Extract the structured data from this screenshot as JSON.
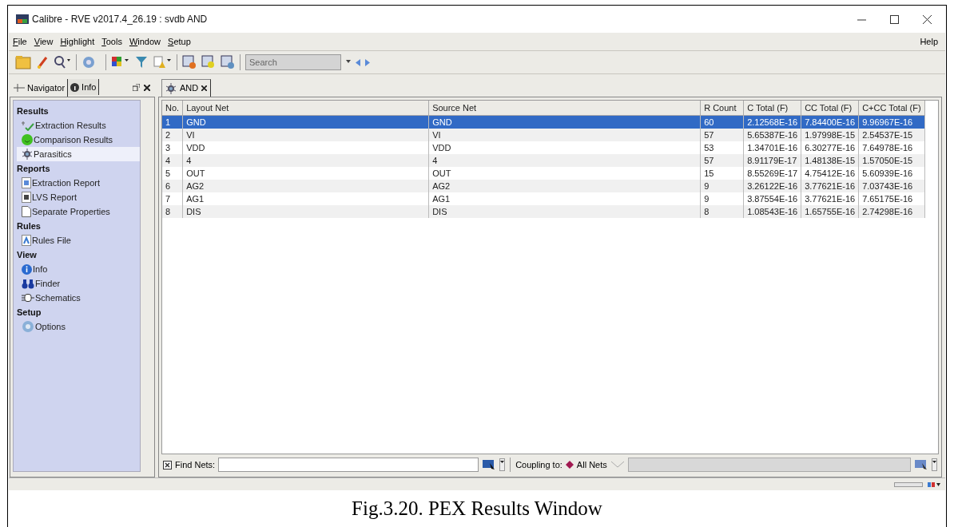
{
  "window": {
    "title": "Calibre - RVE v2017.4_26.19 : svdb AND"
  },
  "menu": [
    "File",
    "View",
    "Highlight",
    "Tools",
    "Window",
    "Setup"
  ],
  "help": "Help",
  "toolbar": {
    "search": {
      "placeholder": "Search"
    }
  },
  "side_tabs": [
    {
      "label": "Navigator",
      "selected": true
    },
    {
      "label": "Info",
      "selected": false
    }
  ],
  "navigator": [
    {
      "heading": "Results",
      "items": [
        {
          "label": "Extraction Results",
          "kind": "extraction",
          "selected": false
        },
        {
          "label": "Comparison Results",
          "kind": "smiley",
          "selected": false
        },
        {
          "label": "Parasitics",
          "kind": "bug",
          "selected": true
        }
      ]
    },
    {
      "heading": "Reports",
      "items": [
        {
          "label": "Extraction Report",
          "kind": "reportE",
          "selected": false
        },
        {
          "label": "LVS Report",
          "kind": "reportL",
          "selected": false
        },
        {
          "label": "Separate Properties",
          "kind": "page",
          "selected": false
        }
      ]
    },
    {
      "heading": "Rules",
      "items": [
        {
          "label": "Rules File",
          "kind": "rules",
          "selected": false
        }
      ]
    },
    {
      "heading": "View",
      "items": [
        {
          "label": "Info",
          "kind": "info",
          "selected": false
        },
        {
          "label": "Finder",
          "kind": "binoculars",
          "selected": false
        },
        {
          "label": "Schematics",
          "kind": "schematic",
          "selected": false
        }
      ]
    },
    {
      "heading": "Setup",
      "items": [
        {
          "label": "Options",
          "kind": "gear",
          "selected": false
        }
      ]
    }
  ],
  "doc_tabs": [
    {
      "label": "AND",
      "selected": true
    }
  ],
  "table": {
    "columns": [
      "No.",
      "Layout Net",
      "Source Net",
      "R Count",
      "C Total (F)",
      "CC Total (F)",
      "C+CC Total (F)"
    ],
    "rows": [
      {
        "cells": [
          "1",
          "GND",
          "GND",
          "60",
          "2.12568E-16",
          "7.84400E-16",
          "9.96967E-16"
        ],
        "selected": true
      },
      {
        "cells": [
          "2",
          "VI",
          "VI",
          "57",
          "5.65387E-16",
          "1.97998E-15",
          "2.54537E-15"
        ],
        "selected": false
      },
      {
        "cells": [
          "3",
          "VDD",
          "VDD",
          "53",
          "1.34701E-16",
          "6.30277E-16",
          "7.64978E-16"
        ],
        "selected": false
      },
      {
        "cells": [
          "4",
          "4",
          "4",
          "57",
          "8.91179E-17",
          "1.48138E-15",
          "1.57050E-15"
        ],
        "selected": false
      },
      {
        "cells": [
          "5",
          "OUT",
          "OUT",
          "15",
          "8.55269E-17",
          "4.75412E-16",
          "5.60939E-16"
        ],
        "selected": false
      },
      {
        "cells": [
          "6",
          "AG2",
          "AG2",
          "9",
          "3.26122E-16",
          "3.77621E-16",
          "7.03743E-16"
        ],
        "selected": false
      },
      {
        "cells": [
          "7",
          "AG1",
          "AG1",
          "9",
          "3.87554E-16",
          "3.77621E-16",
          "7.65175E-16"
        ],
        "selected": false
      },
      {
        "cells": [
          "8",
          "DIS",
          "DIS",
          "8",
          "1.08543E-16",
          "1.65755E-16",
          "2.74298E-16"
        ],
        "selected": false
      }
    ]
  },
  "find_bar": {
    "label": "Find Nets:",
    "coupling_label": "Coupling to:",
    "coupling_value": "All Nets"
  },
  "caption": "Fig.3.20. PEX Results Window"
}
